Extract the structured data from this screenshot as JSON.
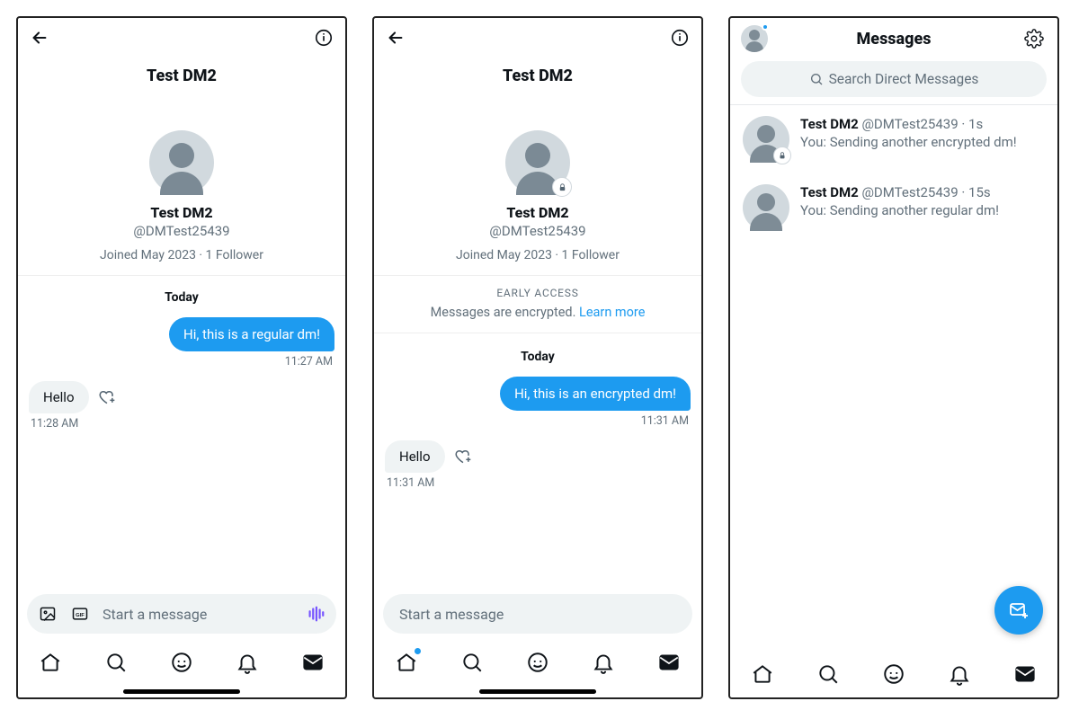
{
  "screen1": {
    "title": "Test DM2",
    "profile": {
      "name": "Test DM2",
      "handle": "@DMTest25439",
      "meta": "Joined May 2023 · 1 Follower"
    },
    "day_separator": "Today",
    "messages": {
      "out_text": "Hi, this is a regular dm!",
      "out_time": "11:27 AM",
      "in_text": "Hello",
      "in_time": "11:28 AM"
    },
    "composer_placeholder": "Start a message"
  },
  "screen2": {
    "title": "Test DM2",
    "profile": {
      "name": "Test DM2",
      "handle": "@DMTest25439",
      "meta": "Joined May 2023 · 1 Follower"
    },
    "banner": {
      "tag": "EARLY ACCESS",
      "text": "Messages are encrypted. ",
      "link": "Learn more"
    },
    "day_separator": "Today",
    "messages": {
      "out_text": "Hi, this is an encrypted dm!",
      "out_time": "11:31 AM",
      "in_text": "Hello",
      "in_time": "11:31 AM"
    },
    "composer_placeholder": "Start a message"
  },
  "screen3": {
    "title": "Messages",
    "search_placeholder": "Search Direct Messages",
    "conversations": [
      {
        "name": "Test DM2",
        "handle": "@DMTest25439",
        "time": "1s",
        "preview": "You: Sending another encrypted dm!",
        "encrypted": true
      },
      {
        "name": "Test DM2",
        "handle": "@DMTest25439",
        "time": "15s",
        "preview": "You: Sending another regular dm!",
        "encrypted": false
      }
    ]
  }
}
